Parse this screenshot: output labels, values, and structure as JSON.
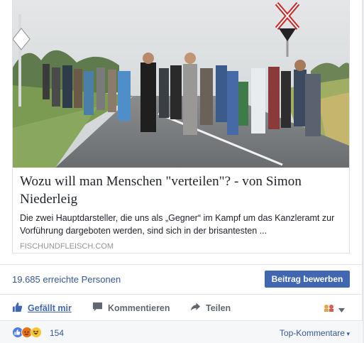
{
  "link_preview": {
    "image_icon": "photo-refugees-on-road",
    "title": "Wozu will man Menschen \"verteilen\"? - von Simon Niederleig",
    "description": "Die zwei Hauptdarsteller, die uns als „Gegner“ im Kampf um das Kanzleramt zur Vorführung dargeboten werden, sind sich in der brisantesten ...",
    "domain": "FISCHUNDFLEISCH.COM"
  },
  "reach": {
    "text": "19.685 erreichte Personen",
    "boost_label": "Beitrag bewerben"
  },
  "actions": {
    "like_label": "Gefällt mir",
    "comment_label": "Kommentieren",
    "share_label": "Teilen",
    "like_icon": "thumbs-up-icon",
    "comment_icon": "speech-bubble-icon",
    "share_icon": "share-arrow-icon",
    "audience_icon": "audience-selector-icon"
  },
  "reactions": {
    "count": "154",
    "icons": [
      "like",
      "angry",
      "haha"
    ],
    "sort_label": "Top-Kommentare"
  },
  "colors": {
    "link_blue": "#365899",
    "button_blue": "#4267b2",
    "text_dark": "#1d2129",
    "text_gray": "#606770"
  }
}
